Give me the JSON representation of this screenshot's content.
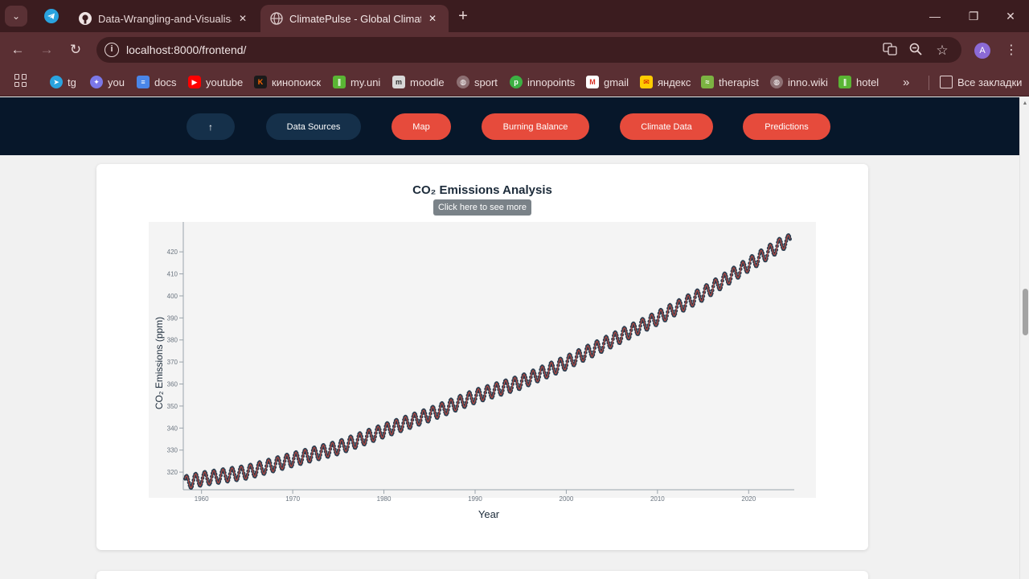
{
  "browser": {
    "tabs": [
      {
        "title": "Data-Wrangling-and-Visualisati",
        "close": "✕"
      },
      {
        "title": "ClimatePulse - Global Climate C",
        "close": "✕"
      }
    ],
    "new_tab": "+",
    "url": "localhost:8000/frontend/",
    "avatar_letter": "A",
    "bookmarks": [
      "tg",
      "you",
      "docs",
      "youtube",
      "кинопоиск",
      "my.uni",
      "moodle",
      "sport",
      "innopoints",
      "gmail",
      "яндекс",
      "therapist",
      "inno.wiki",
      "hotel"
    ],
    "more_bookmarks": "»",
    "all_bookmarks": "Все закладки"
  },
  "nav": {
    "buttons": [
      "↑",
      "Data Sources",
      "Map",
      "Burning Balance",
      "Climate Data",
      "Predictions"
    ]
  },
  "chart_section": {
    "title": "CO₂ Emissions Analysis",
    "more_button": "Click here to see more"
  },
  "chart_data": {
    "type": "line",
    "title": "CO₂ Emissions Analysis",
    "xlabel": "Year",
    "ylabel": "CO₂ Emissions (ppm)",
    "xlim": [
      1958,
      2025
    ],
    "ylim": [
      312,
      427
    ],
    "x_ticks": [
      1960,
      1970,
      1980,
      1990,
      2000,
      2010,
      2020
    ],
    "y_ticks": [
      320,
      330,
      340,
      350,
      360,
      370,
      380,
      390,
      400,
      410,
      420
    ],
    "grid": false,
    "series": [
      {
        "style": "points + trend line",
        "point_color": "#2c3e50",
        "line_color": "#e74c3c",
        "x": [
          1958,
          1960,
          1965,
          1970,
          1975,
          1980,
          1985,
          1990,
          1995,
          2000,
          2005,
          2010,
          2015,
          2020,
          2024
        ],
        "y": [
          315,
          316.9,
          320.0,
          325.7,
          331.1,
          338.8,
          346.1,
          354.4,
          360.8,
          369.7,
          379.8,
          389.9,
          401.0,
          414.2,
          424.6
        ],
        "seasonal_amplitude": 3
      }
    ]
  }
}
